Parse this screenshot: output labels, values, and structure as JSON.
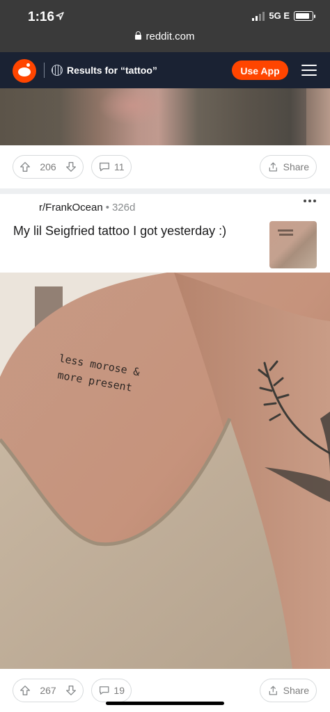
{
  "status_bar": {
    "time": "1:16",
    "network": "5G E",
    "location_icon": "location-arrow-icon"
  },
  "browser": {
    "url": "reddit.com",
    "lock_icon": "lock-icon"
  },
  "header": {
    "logo_icon": "reddit-snoo-icon",
    "search_label": "Results for “tattoo”",
    "use_app_label": "Use App",
    "menu_icon": "hamburger-menu-icon",
    "accent_color": "#ff4500",
    "header_bg": "#1a2233"
  },
  "previous_post": {
    "upvotes": "206",
    "comments": "11",
    "share_label": "Share"
  },
  "post": {
    "subreddit": "r/FrankOcean",
    "age": "326d",
    "title": "My lil Seigfried tattoo I got yesterday :)",
    "tattoo_text_line1": "less morose &",
    "tattoo_text_line2": "more present",
    "upvotes": "267",
    "comments": "19",
    "share_label": "Share"
  }
}
